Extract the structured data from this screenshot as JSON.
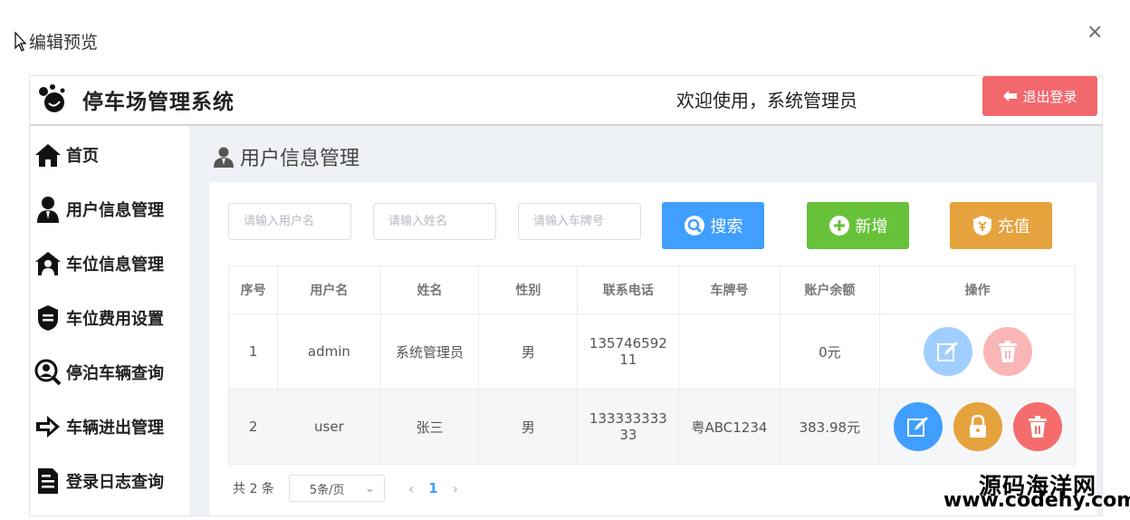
{
  "dialog": {
    "title": "编辑预览",
    "close": "×"
  },
  "header": {
    "system_title": "停车场管理系统",
    "welcome": "欢迎使用，系统管理员",
    "logout_label": "退出登录"
  },
  "sidebar": {
    "items": [
      {
        "label": "首页",
        "icon": "home-icon"
      },
      {
        "label": "用户信息管理",
        "icon": "user-icon"
      },
      {
        "label": "车位信息管理",
        "icon": "parking-space-icon"
      },
      {
        "label": "车位费用设置",
        "icon": "fee-shield-icon"
      },
      {
        "label": "停泊车辆查询",
        "icon": "search-person-icon"
      },
      {
        "label": "车辆进出管理",
        "icon": "arrow-in-out-icon"
      },
      {
        "label": "登录日志查询",
        "icon": "log-document-icon"
      }
    ]
  },
  "main": {
    "page_title": "用户信息管理",
    "search": {
      "username_placeholder": "请输入用户名",
      "name_placeholder": "请输入姓名",
      "plate_placeholder": "请输入车牌号",
      "search_label": "搜索",
      "add_label": "新增",
      "recharge_label": "充值"
    },
    "table": {
      "headers": [
        "序号",
        "用户名",
        "姓名",
        "性别",
        "联系电话",
        "车牌号",
        "账户余额",
        "操作"
      ],
      "rows": [
        {
          "index": "1",
          "username": "admin",
          "name": "系统管理员",
          "gender": "男",
          "phone_l1": "135746592",
          "phone_l2": "11",
          "plate": "",
          "balance": "0元"
        },
        {
          "index": "2",
          "username": "user",
          "name": "张三",
          "gender": "男",
          "phone_l1": "133333333",
          "phone_l2": "33",
          "plate": "粤ABC1234",
          "balance": "383.98元"
        }
      ]
    },
    "pager": {
      "total": "共 2 条",
      "page_size": "5条/页",
      "prev": "‹",
      "current": "1",
      "next": "›",
      "dropdown": "⌄"
    }
  },
  "watermark": {
    "line1": "源码海洋网",
    "line2": "www.codehy.com"
  },
  "colors": {
    "search": "#409eff",
    "add": "#67c23a",
    "recharge": "#e6a23c",
    "logout": "#f3686d",
    "delete": "#f56c6c"
  }
}
